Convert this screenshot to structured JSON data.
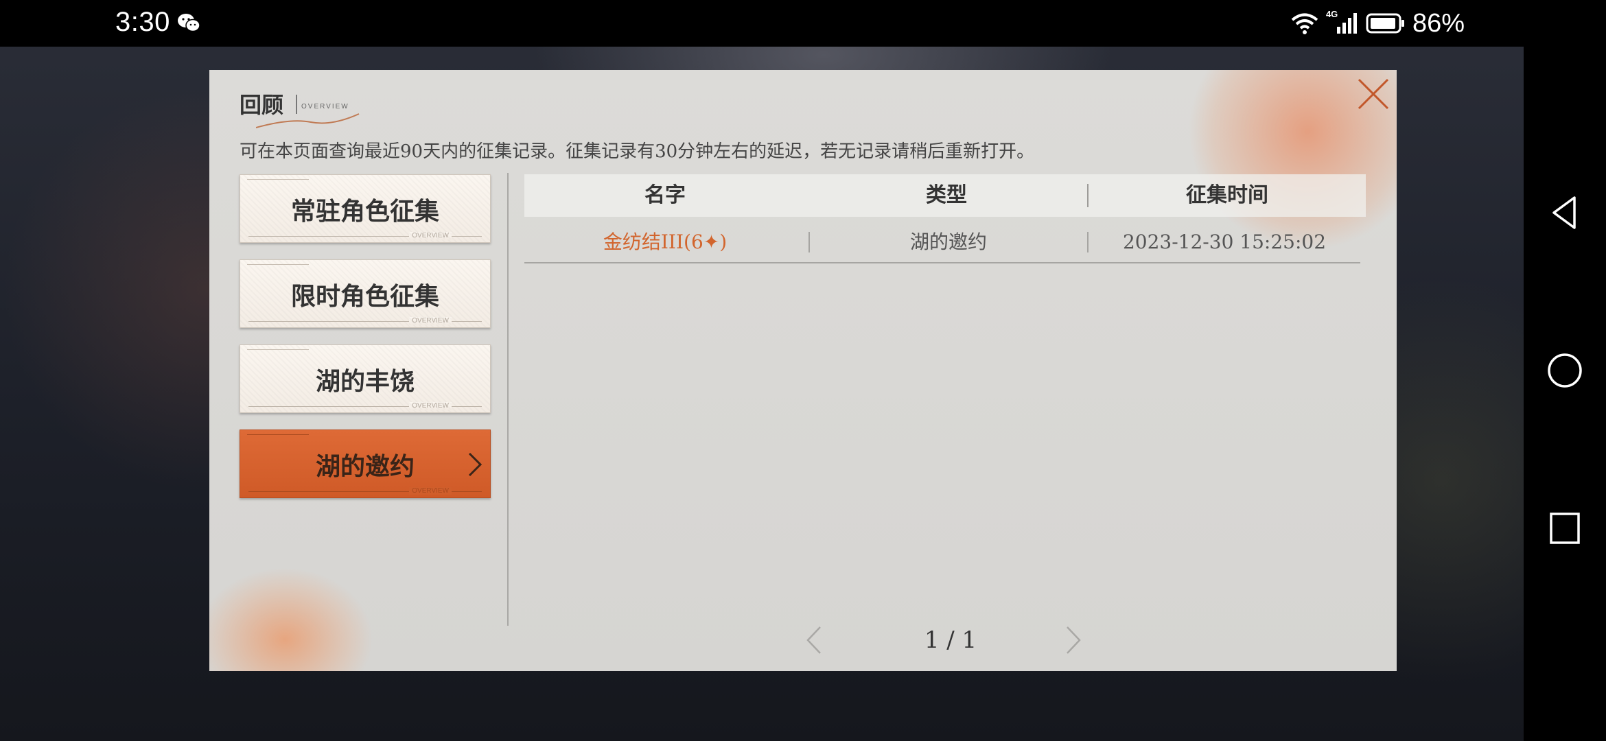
{
  "status_bar": {
    "time": "3:30",
    "battery_percent": "86%",
    "network_label": "4G",
    "icons": [
      "wechat-icon",
      "wifi-icon",
      "signal-icon",
      "battery-icon"
    ]
  },
  "dialog": {
    "title": "回顾",
    "title_sub": "OVERVIEW",
    "notice": "可在本页面查询最近90天内的征集记录。征集记录有30分钟左右的延迟，若无记录请稍后重新打开。",
    "menu": [
      {
        "label": "常驻角色征集",
        "active": false
      },
      {
        "label": "限时角色征集",
        "active": false
      },
      {
        "label": "湖的丰饶",
        "active": false
      },
      {
        "label": "湖的邀约",
        "active": true
      }
    ],
    "menu_deco_tag": "OVERVIEW",
    "table": {
      "headers": [
        "名字",
        "类型",
        "征集时间"
      ],
      "rows": [
        {
          "name": "金纺结III(6✦)",
          "type": "湖的邀约",
          "time": "2023-12-30 15:25:02"
        }
      ]
    },
    "pagination": {
      "text": "1 / 1",
      "current": 1,
      "total": 1
    }
  },
  "colors": {
    "accent": "#d0602c",
    "name_highlight": "#d2652d",
    "dialog_bg": "#d8d7d4"
  }
}
